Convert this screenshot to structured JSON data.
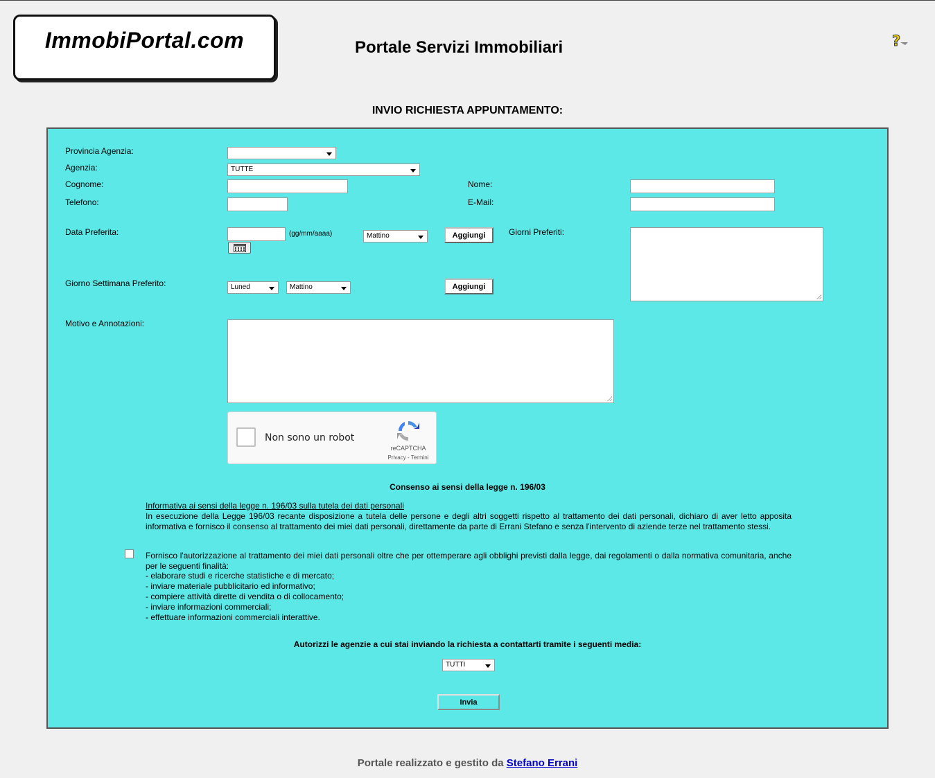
{
  "header": {
    "logo_text": "ImmobiPortal.com",
    "site_title": "Portale Servizi Immobiliari",
    "help_icon": "help-question-icon"
  },
  "page_heading": "INVIO RICHIESTA APPUNTAMENTO:",
  "form": {
    "provincia_label": "Provincia Agenzia:",
    "provincia_value": "",
    "agenzia_label": "Agenzia:",
    "agenzia_value": "TUTTE",
    "cognome_label": "Cognome:",
    "nome_label": "Nome:",
    "telefono_label": "Telefono:",
    "email_label": "E-Mail:",
    "data_label": "Data Preferita:",
    "data_format_hint": "(gg/mm/aaaa)",
    "data_fascia_value": "Mattino",
    "aggiungi_label": "Aggiungi",
    "giorni_preferiti_label": "Giorni Preferiti:",
    "giorno_settimana_label": "Giorno Settimana Preferito:",
    "giorno_value": "Luned",
    "giorno_fascia_value": "Mattino",
    "aggiungi2_label": "Aggiungi",
    "motivo_label": "Motivo e Annotazioni:",
    "calendar_icon": "calendar-icon"
  },
  "recaptcha": {
    "label": "Non sono un robot",
    "brand": "reCAPTCHA",
    "links": "Privacy - Termini"
  },
  "consent": {
    "title": "Consenso ai sensi della legge n. 196/03",
    "info_link": "Informativa ai sensi della legge n. 196/03 sulla tutela dei dati personali",
    "info_text": "In esecuzione della Legge 196/03 recante disposizione a tutela delle persone e degli altri soggetti rispetto al trattamento dei dati personali, dichiaro di aver letto apposita informativa e fornisco il consenso al trattamento dei miei dati personali, direttamente da parte di Errani Stefano e senza l'intervento di aziende terze nel trattamento stessi.",
    "auth_text": "Fornisco l'autorizzazione al trattamento dei miei dati personali oltre che per ottemperare agli obblighi previsti dalla legge, dai regolamenti o dalla normativa comunitaria, anche per le seguenti finalità:",
    "purposes": [
      "- elaborare studi e ricerche statistiche e di mercato;",
      "- inviare materiale pubblicitario ed informativo;",
      "- compiere attività dirette di vendita o di collocamento;",
      "- inviare informazioni commerciali;",
      "- effettuare informazioni commerciali interattive."
    ]
  },
  "media": {
    "title": "Autorizzi le agenzie a cui stai inviando la richiesta a contattarti tramite i seguenti media:",
    "value": "TUTTI"
  },
  "submit_label": "Invia",
  "footer": {
    "text": "Portale realizzato e gestito da",
    "author": "Stefano Errani"
  }
}
